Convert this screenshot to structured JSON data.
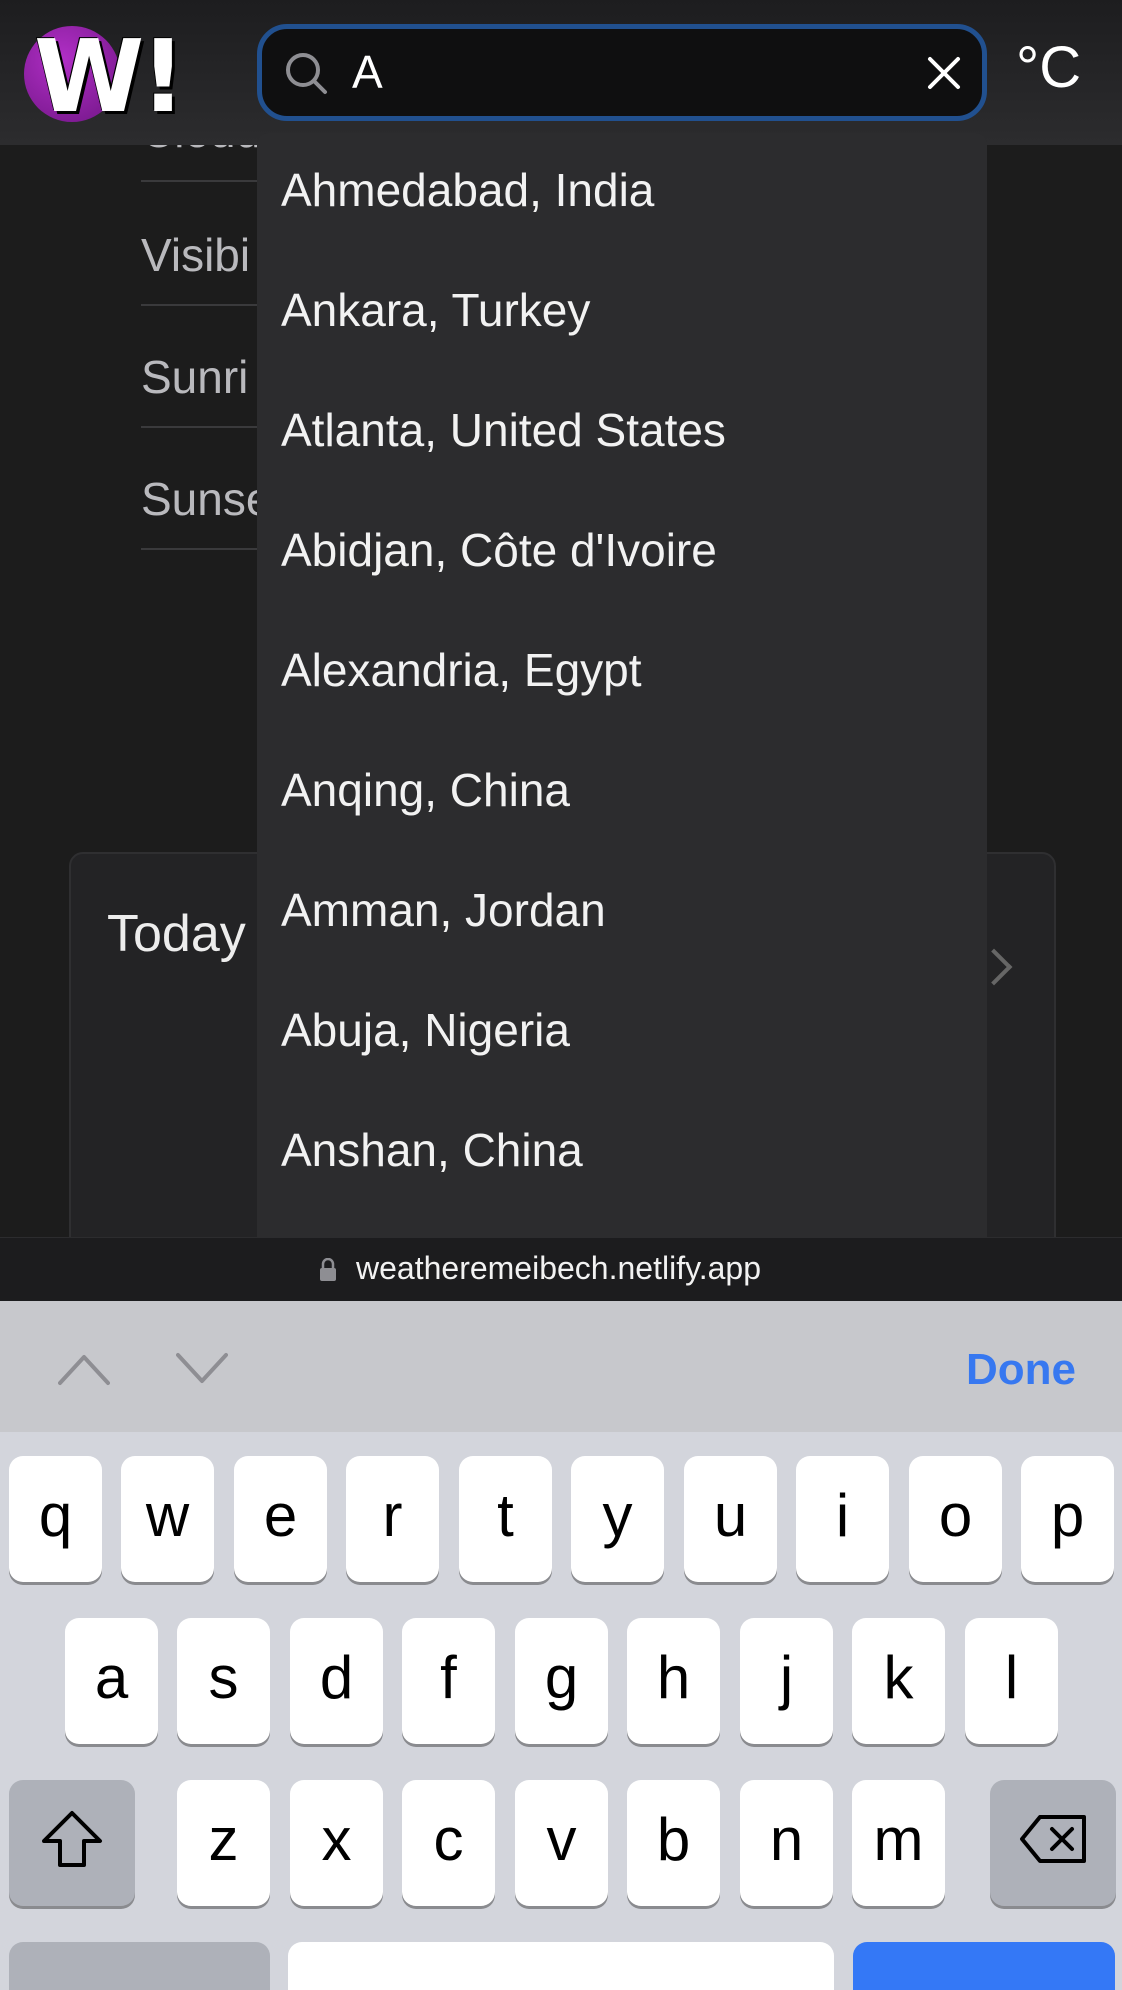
{
  "header": {
    "logo_text": "W!",
    "search_value": "A",
    "unit_label": "°C"
  },
  "details": [
    {
      "label": "Cloud"
    },
    {
      "label": "Visibi"
    },
    {
      "label": "Sunri"
    },
    {
      "label": "Sunse"
    }
  ],
  "today_card": {
    "title": "Today"
  },
  "suggestions": [
    "Ahmedabad, India",
    "Ankara, Turkey",
    "Atlanta, United States",
    "Abidjan, Côte d'Ivoire",
    "Alexandria, Egypt",
    "Anqing, China",
    "Amman, Jordan",
    "Abuja, Nigeria",
    "Anshan, China"
  ],
  "url_bar": {
    "url": "weatheremeibech.netlify.app",
    "icon": "lock-icon"
  },
  "accessory": {
    "done_label": "Done"
  },
  "keyboard": {
    "row1": [
      "q",
      "w",
      "e",
      "r",
      "t",
      "y",
      "u",
      "i",
      "o",
      "p"
    ],
    "row2": [
      "a",
      "s",
      "d",
      "f",
      "g",
      "h",
      "j",
      "k",
      "l"
    ],
    "row3": [
      "z",
      "x",
      "c",
      "v",
      "b",
      "n",
      "m"
    ]
  },
  "colors": {
    "accent": "#21508f",
    "done": "#3778f0",
    "logo": "#8e22a6",
    "dropdown_bg": "#2c2c2e"
  }
}
